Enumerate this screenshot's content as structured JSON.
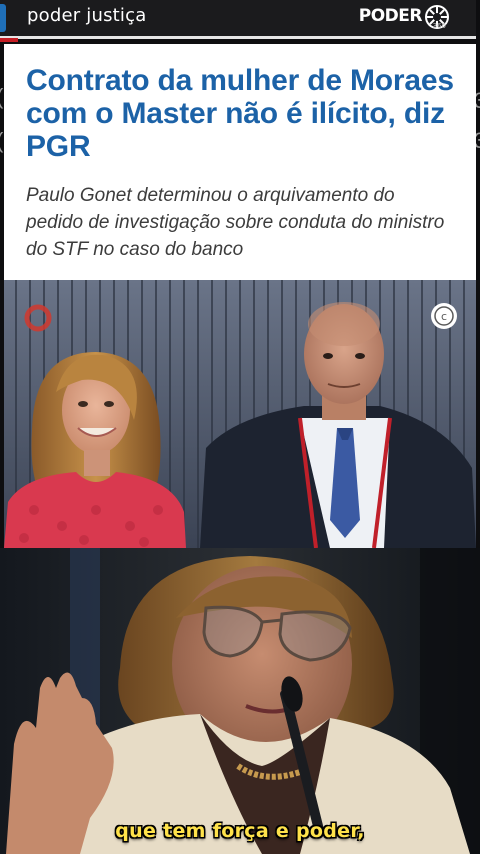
{
  "header": {
    "section": "poder justiça",
    "logo_text": "PODER",
    "logo_sub": "360",
    "logo_icon": "poder360-sun-icon"
  },
  "article": {
    "headline": "Contrato da mulher de Moraes com o Master não é ilícito, diz PGR",
    "subhead": "Paulo Gonet determinou o arquivamento do pedido de investigação sobre conduta do ministro do STF no caso do banco",
    "photo_credit_icon": "copyright-icon",
    "accent_color": "#1c62a7"
  },
  "video": {
    "caption": "que tem força e poder,",
    "caption_color": "#ffe24a"
  }
}
